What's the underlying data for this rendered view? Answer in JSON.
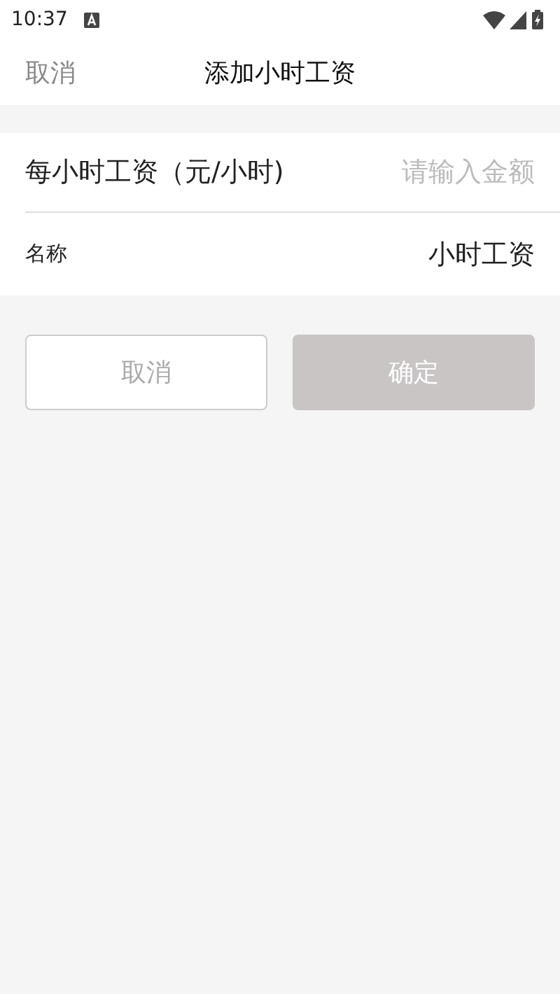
{
  "status_bar": {
    "time": "10:37"
  },
  "header": {
    "cancel": "取消",
    "title": "添加小时工资"
  },
  "form": {
    "rows": [
      {
        "kind": "input",
        "label": "每小时工资（元/小时)",
        "placeholder": "请输入金额"
      },
      {
        "kind": "value",
        "label": "名称",
        "value": "小时工资"
      }
    ]
  },
  "buttons": [
    {
      "kind": "outline",
      "label": "取消",
      "disabled": false
    },
    {
      "kind": "filled",
      "label": "确定",
      "disabled": true
    }
  ]
}
